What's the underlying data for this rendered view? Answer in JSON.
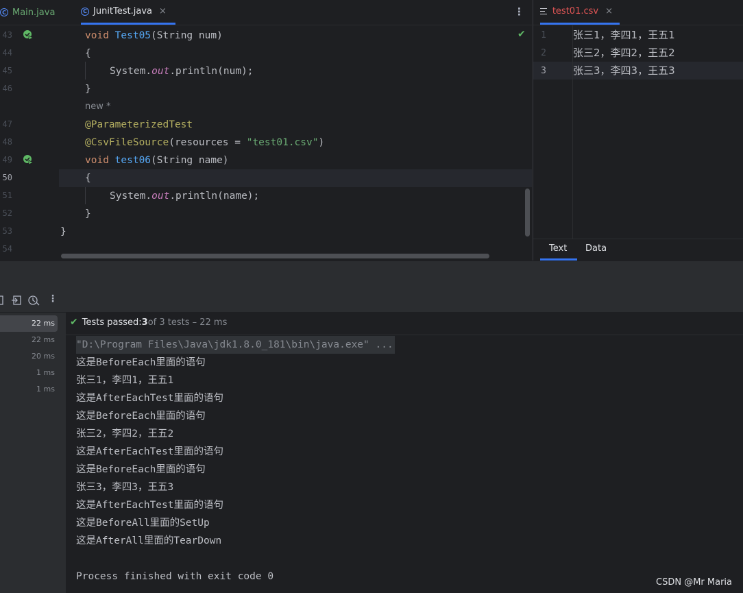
{
  "editor": {
    "tabs": [
      {
        "label": "Main.java"
      },
      {
        "label": "JunitTest.java",
        "close": "×"
      }
    ],
    "more": "⋮",
    "line_numbers": [
      "43",
      "44",
      "45",
      "46",
      "",
      "47",
      "48",
      "49",
      "50",
      "51",
      "52",
      "53",
      "54"
    ],
    "code": {
      "l43_kw": "void ",
      "l43_fn": "Test05",
      "l43_rest": "(String num)",
      "l44": "{",
      "l45_a": "System.",
      "l45_b": "out",
      "l45_c": ".println(num);",
      "l46": "}",
      "hint": "new *",
      "l47": "@ParameterizedTest",
      "l48_ann": "@CsvFileSource",
      "l48_a": "(resources = ",
      "l48_str": "\"test01.csv\"",
      "l48_b": ")",
      "l49_kw": "void ",
      "l49_fn": "test06",
      "l49_rest": "(String name)",
      "l50": "{",
      "l51_a": "System.",
      "l51_b": "out",
      "l51_c": ".println(name);",
      "l52": "}",
      "l53": "}"
    }
  },
  "csv": {
    "tab_label": "test01.csv",
    "close": "×",
    "line_numbers": [
      "1",
      "2",
      "3"
    ],
    "rows": [
      "张三1，李四1，王五1",
      "张三2，李四2，王五2",
      "张三3，李四3，王五3"
    ],
    "subtabs": {
      "text": "Text",
      "data": "Data"
    }
  },
  "run": {
    "more": "⋮",
    "tree_times": [
      "22 ms",
      "22 ms",
      "20 ms",
      "1 ms",
      "1 ms"
    ],
    "status": {
      "label": "Tests passed: ",
      "passed": "3",
      "of_total": " of 3 tests – 22 ms"
    },
    "output": [
      "\"D:\\Program Files\\Java\\jdk1.8.0_181\\bin\\java.exe\" ...",
      "这是BeforeEach里面的语句",
      "张三1，李四1，王五1",
      "这是AfterEachTest里面的语句",
      "这是BeforeEach里面的语句",
      "张三2，李四2，王五2",
      "这是AfterEachTest里面的语句",
      "这是BeforeEach里面的语句",
      "张三3，李四3，王五3",
      "这是AfterEachTest里面的语句",
      "这是BeforeAll里面的SetUp",
      "这是AfterAll里面的TearDown",
      "",
      "Process finished with exit code 0"
    ]
  },
  "watermark": "CSDN @Mr Maria",
  "colors": {
    "accent": "#3574f0",
    "success": "#5fb865",
    "keyword": "#cf8e6d",
    "function": "#56a8f5",
    "annotation": "#b3ae60",
    "string": "#6aab73"
  }
}
